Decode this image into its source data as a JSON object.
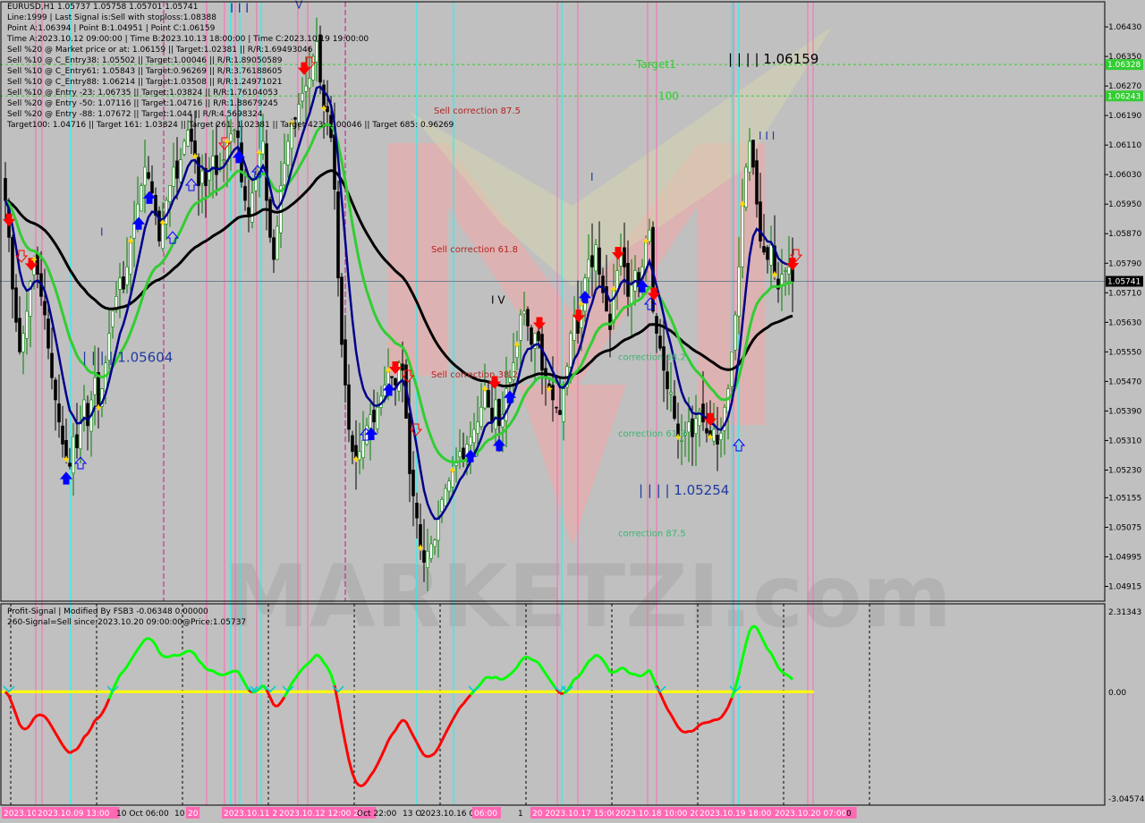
{
  "header": {
    "lines": [
      "EURUSD,H1  1.05737 1.05758 1.05701 1.05741",
      "Line:1999  | Last Signal is:Sell with stoploss:1.08388",
      "Point A:1.06394  | Point B:1.04951  | Point C:1.06159",
      "Time A:2023.10.12 09:00:00 | Time B:2023.10.13 18:00:00  | Time C:2023.10.19 19:00:00",
      "Sell %20 @ Market price or at: 1.06159  || Target:1.02381 || R/R:1.69493046",
      "Sell %10 @ C_Entry38: 1.05502  || Target:1.00046 || R/R:1.89050589",
      "Sell %10 @ C_Entry61: 1.05843  || Target:0.96269 || R/R:3.76188605",
      "Sell %10 @ C_Entry88: 1.06214  || Target:1.03508 || R/R:1.24971021",
      "Sell %10 @ Entry -23: 1.06735  || Target:1.03824 || R/R:1.76104053",
      "Sell %20 @ Entry -50: 1.07116  || Target:1.04716 || R/R:1.88679245",
      "Sell %20 @ Entry -88: 1.07672  || Target:1.044 || R/R:4.5698324",
      "Target100: 1.04716  || Target 161: 1.03824  || Target 261: 1.02381  || Target 423: 1.00046  || Target 685: 0.96269"
    ]
  },
  "indicator": {
    "title": "Profit-Signal | Modified By FSB3 -0.06348 0.00000",
    "signal": "260-Signal=Sell since:2023.10.20 09:00:00@Price:1.05737"
  },
  "colors": {
    "background": "#c0c0c0",
    "bull_candle": "#008000",
    "bear_candle": "#000000",
    "ma_fast": "#00008b",
    "ma_mid": "#32cd32",
    "ma_slow": "#000000",
    "target_green": "#32cd32",
    "cyan_line": "#00ffff",
    "magenta_line": "#ff69b4",
    "sell_arrow": "#ff0000",
    "buy_arrow": "#0000ff",
    "oscillator_up": "#00ff00",
    "oscillator_down": "#ff0000",
    "zero_line": "#ffff00",
    "watermark": "MARKETZI.com"
  },
  "chart_data": [
    {
      "type": "candlestick",
      "symbol": "EURUSD",
      "timeframe": "H1",
      "ohlc_last": {
        "open": 1.05737,
        "high": 1.05758,
        "low": 1.05701,
        "close": 1.05741
      },
      "ylim": [
        1.04875,
        1.06498
      ],
      "y_ticks": [
        "1.06430",
        "1.06350",
        "1.06270",
        "1.06190",
        "1.06110",
        "1.06030",
        "1.05950",
        "1.05870",
        "1.05790",
        "1.05710",
        "1.05630",
        "1.05550",
        "1.05470",
        "1.05390",
        "1.05310",
        "1.05230",
        "1.05155",
        "1.05075",
        "1.04995",
        "1.04915"
      ],
      "price_labels": {
        "current": "1.05741",
        "target1_price": "1.06328",
        "target100_price": "1.06243"
      },
      "x_ticks": [
        "2023.10.",
        "2023.10.09 13:00",
        "10 Oct 06:00",
        "10",
        "20",
        "2023.10.11 2",
        "2023.10.12 12:00 20",
        "Oct 22:00",
        "13 O",
        "2023.10.16 06:00",
        "06:00",
        "1",
        "20 2023.10.17 15:00",
        "2023.10.18 10:00 20",
        "2023.10.19 18:00",
        "2023.10.20 07:00",
        "0"
      ],
      "closes": [
        1.0596,
        1.0586,
        1.0572,
        1.0563,
        1.0555,
        1.056,
        1.0566,
        1.0574,
        1.058,
        1.0576,
        1.057,
        1.0565,
        1.0556,
        1.0548,
        1.0542,
        1.0536,
        1.053,
        1.0526,
        1.0524,
        1.0532,
        1.0529,
        1.0536,
        1.0542,
        1.0535,
        1.0542,
        1.0548,
        1.054,
        1.0545,
        1.0552,
        1.056,
        1.0566,
        1.057,
        1.0575,
        1.0572,
        1.0578,
        1.0585,
        1.059,
        1.0595,
        1.06,
        1.0605,
        1.0602,
        1.0598,
        1.0592,
        1.0585,
        1.059,
        1.0596,
        1.06,
        1.0605,
        1.0602,
        1.0607,
        1.0612,
        1.0615,
        1.0612,
        1.0608,
        1.06,
        1.0604,
        1.06,
        1.0604,
        1.0608,
        1.0603,
        1.0605,
        1.0607,
        1.0612,
        1.0614,
        1.0615,
        1.0613,
        1.0601,
        1.0596,
        1.0592,
        1.0598,
        1.0603,
        1.0609,
        1.0612,
        1.0596,
        1.0586,
        1.058,
        1.0589,
        1.06,
        1.0606,
        1.0612,
        1.0617,
        1.0618,
        1.0622,
        1.0625,
        1.0627,
        1.0629,
        1.0635,
        1.0639,
        1.0628,
        1.0621,
        1.062,
        1.0613,
        1.0599,
        1.0575,
        1.0557,
        1.0546,
        1.0534,
        1.0528,
        1.0526,
        1.0528,
        1.0531,
        1.0535,
        1.0538,
        1.0536,
        1.054,
        1.0543,
        1.0546,
        1.055,
        1.0548,
        1.0546,
        1.0552,
        1.055,
        1.0537,
        1.0522,
        1.0516,
        1.051,
        1.0502,
        1.0498,
        1.0501,
        1.0503,
        1.0504,
        1.051,
        1.0515,
        1.0518,
        1.052,
        1.0523,
        1.0525,
        1.0528,
        1.0526,
        1.053,
        1.0532,
        1.0534,
        1.0536,
        1.054,
        1.0545,
        1.054,
        1.0536,
        1.0542,
        1.0535,
        1.0538,
        1.0545,
        1.0548,
        1.0552,
        1.0557,
        1.0565,
        1.0566,
        1.0562,
        1.0557,
        1.056,
        1.0558,
        1.055,
        1.0548,
        1.0545,
        1.0542,
        1.054,
        1.0538,
        1.0545,
        1.0551,
        1.056,
        1.0565,
        1.056,
        1.0568,
        1.0575,
        1.058,
        1.0578,
        1.0584,
        1.0576,
        1.0571,
        1.0566,
        1.0561,
        1.0572,
        1.0577,
        1.0582,
        1.0578,
        1.057,
        1.0573,
        1.0577,
        1.0573,
        1.0578,
        1.0585,
        1.0588,
        1.0566,
        1.056,
        1.0556,
        1.055,
        1.0545,
        1.0544,
        1.0537,
        1.0532,
        1.0531,
        1.0533,
        1.0536,
        1.0532,
        1.0537,
        1.0539,
        1.0536,
        1.0533,
        1.0532,
        1.0534,
        1.053,
        1.0533,
        1.054,
        1.0545,
        1.0555,
        1.0565,
        1.0578,
        1.0595,
        1.0605,
        1.0612,
        1.0605,
        1.0595,
        1.0585,
        1.0582,
        1.058,
        1.0584,
        1.0576,
        1.0572,
        1.0576,
        1.0577,
        1.0578,
        1.05741
      ],
      "lines": [
        {
          "name": "Target1",
          "value": 1.06328
        },
        {
          "name": "100",
          "value": 1.06243
        }
      ],
      "annotations": [
        {
          "text": "Target1",
          "value": 1.06328
        },
        {
          "text": "100",
          "value": 1.06243
        },
        {
          "text": "Sell correction 87.5",
          "value": 1.06205
        },
        {
          "text": "Sell correction 61.8",
          "value": 1.0583
        },
        {
          "text": "Sell correction 38.2",
          "value": 1.0549
        },
        {
          "text": "| | | | 1.06159",
          "value": 1.0634
        },
        {
          "text": "| | | | 1.05604",
          "value": 1.05533
        },
        {
          "text": "| | | | 1.05254",
          "value": 1.05173
        },
        {
          "text": "correction 38.2",
          "value": 1.05538
        },
        {
          "text": "correction 61.8",
          "value": 1.0533
        },
        {
          "text": "correction 87.5",
          "value": 1.0506
        },
        {
          "text": "I V",
          "value": 1.0569
        },
        {
          "text": "I I I",
          "value": 1.06135
        },
        {
          "text": "I",
          "value": 1.06023
        },
        {
          "text": "I",
          "value": 1.05874
        },
        {
          "text": "I I I",
          "value": 1.06479
        },
        {
          "text": "V",
          "value": 1.06489
        }
      ]
    },
    {
      "type": "line",
      "name": "Profit-Signal",
      "ylim": [
        -3.04574,
        2.31343
      ],
      "y_ticks": [
        "2.31343",
        "0.00",
        "-3.04574"
      ]
    }
  ]
}
